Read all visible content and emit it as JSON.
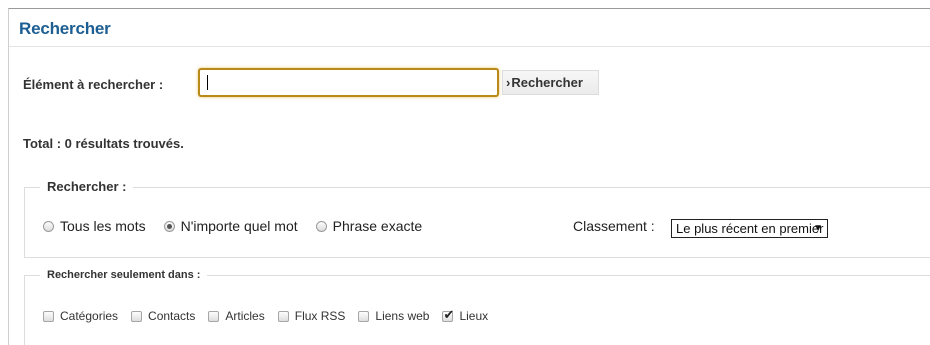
{
  "page": {
    "title": "Rechercher"
  },
  "search": {
    "label": "Élément à rechercher :",
    "value": "",
    "button_arrow": "›",
    "button_label": "Rechercher"
  },
  "results": {
    "total": "Total : 0 résultats trouvés."
  },
  "options": {
    "legend": "Rechercher :",
    "radios": [
      {
        "label": "Tous les mots",
        "checked": false
      },
      {
        "label": "N'importe quel mot",
        "checked": true
      },
      {
        "label": "Phrase exacte",
        "checked": false
      }
    ],
    "order_label": "Classement :",
    "order_value": "Le plus récent en premier",
    "order_arrow": "▼"
  },
  "areas": {
    "legend": "Rechercher seulement dans :",
    "checkboxes": [
      {
        "label": "Catégories",
        "checked": false
      },
      {
        "label": "Contacts",
        "checked": false
      },
      {
        "label": "Articles",
        "checked": false
      },
      {
        "label": "Flux RSS",
        "checked": false
      },
      {
        "label": "Liens web",
        "checked": false
      },
      {
        "label": "Lieux",
        "checked": true
      }
    ]
  },
  "colors": {
    "title": "#1d5e93",
    "focus_border": "#b88a1a"
  }
}
